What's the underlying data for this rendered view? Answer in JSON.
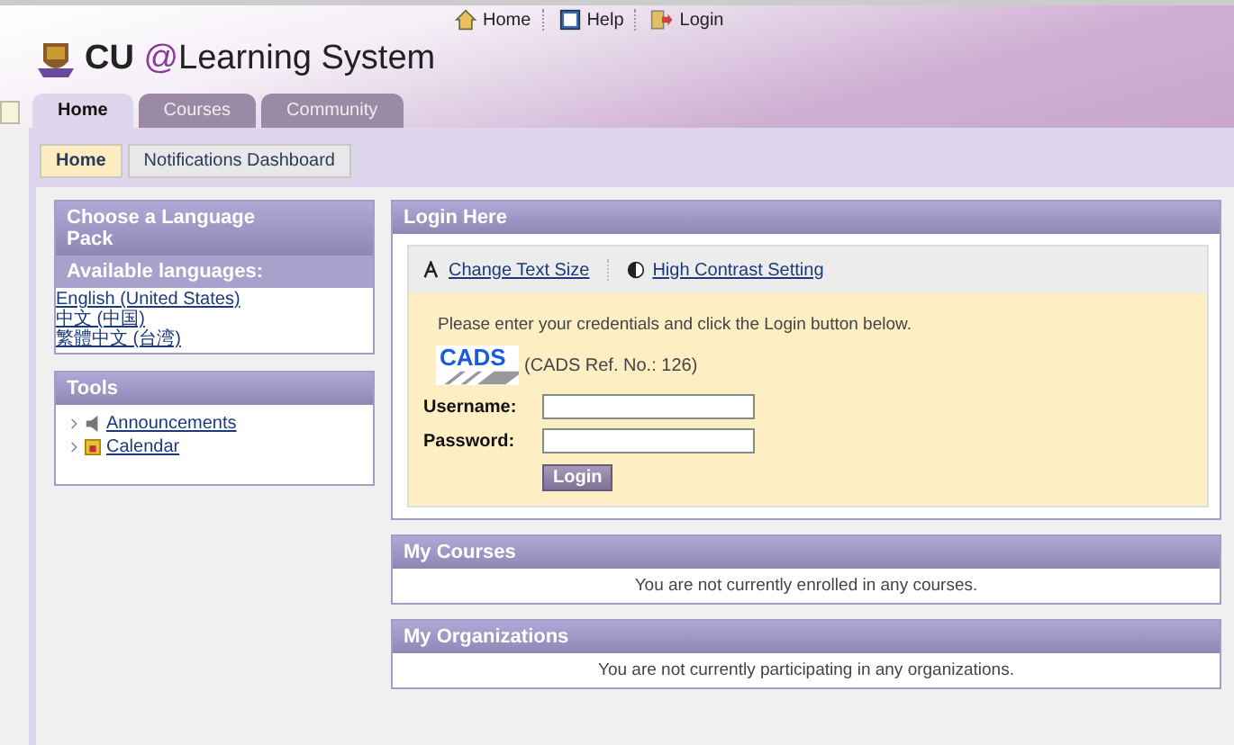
{
  "header": {
    "links": [
      {
        "label": "Home"
      },
      {
        "label": "Help"
      },
      {
        "label": "Login"
      }
    ],
    "brand": {
      "bold": "CU",
      "mark": "@",
      "rest": "Learning System"
    },
    "tabs": [
      {
        "label": "Home",
        "selected": true
      },
      {
        "label": "Courses",
        "selected": false
      },
      {
        "label": "Community",
        "selected": false
      }
    ]
  },
  "subtabs": [
    {
      "label": "Home",
      "selected": true
    },
    {
      "label": "Notifications Dashboard",
      "selected": false
    }
  ],
  "language_panel": {
    "title": "Choose a Language Pack",
    "subtitle": "Available languages:",
    "languages": [
      "English (United States)",
      "中文 (中国)",
      "繁體中文 (台湾)"
    ]
  },
  "tools_panel": {
    "title": "Tools",
    "items": [
      {
        "label": "Announcements"
      },
      {
        "label": "Calendar"
      }
    ]
  },
  "login_panel": {
    "title": "Login Here",
    "links": [
      {
        "label": "Change Text Size"
      },
      {
        "label": "High Contrast Setting"
      }
    ],
    "instructions": "Please enter your credentials and click the Login button below.",
    "cads_logo": "CADS",
    "cads_ref": "(CADS Ref. No.: 126)",
    "fields": [
      {
        "label": "Username:"
      },
      {
        "label": "Password:"
      }
    ],
    "button": "Login"
  },
  "courses_panel": {
    "title": "My Courses",
    "message": "You are not currently enrolled in any courses."
  },
  "organizations_panel": {
    "title": "My Organizations",
    "message": "You are not currently participating in any organizations."
  }
}
